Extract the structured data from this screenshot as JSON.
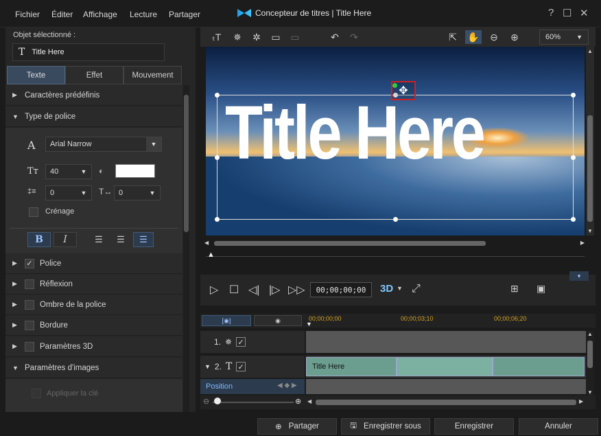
{
  "menu": [
    "Fichier",
    "Éditer",
    "Affichage",
    "Lecture",
    "Partager"
  ],
  "window": {
    "title": "Concepteur de titres | Title Here"
  },
  "left": {
    "selected_label": "Objet sélectionné :",
    "selected_value": "Title Here",
    "tabs": [
      "Texte",
      "Effet",
      "Mouvement"
    ],
    "sections": {
      "presets": "Caractères prédéfinis",
      "font_type": "Type de police",
      "font": "Police",
      "reflection": "Réflexion",
      "shadow": "Ombre de la police",
      "border": "Bordure",
      "params3d": "Paramètres 3D",
      "image_params": "Paramètres d'images",
      "apply_key": "Appliquer la clé"
    },
    "font_name": "Arial Narrow",
    "font_size": "40",
    "line_spacing": "0",
    "char_spacing": "0",
    "kerning": "Crénage",
    "bold": "B",
    "italic": "I"
  },
  "preview": {
    "text": "Title Here",
    "zoom": "60%",
    "timecode": "00;00;00;00",
    "btn3d": "3D"
  },
  "timeline": {
    "ticks": [
      "00;00;00;00",
      "00;00;03;10",
      "00;00;06;20"
    ],
    "track1": "1.",
    "track2": "2.",
    "clip_label": "Title Here",
    "position": "Position"
  },
  "buttons": {
    "share": "Partager",
    "save_as": "Enregistrer sous",
    "save": "Enregistrer",
    "cancel": "Annuler"
  }
}
